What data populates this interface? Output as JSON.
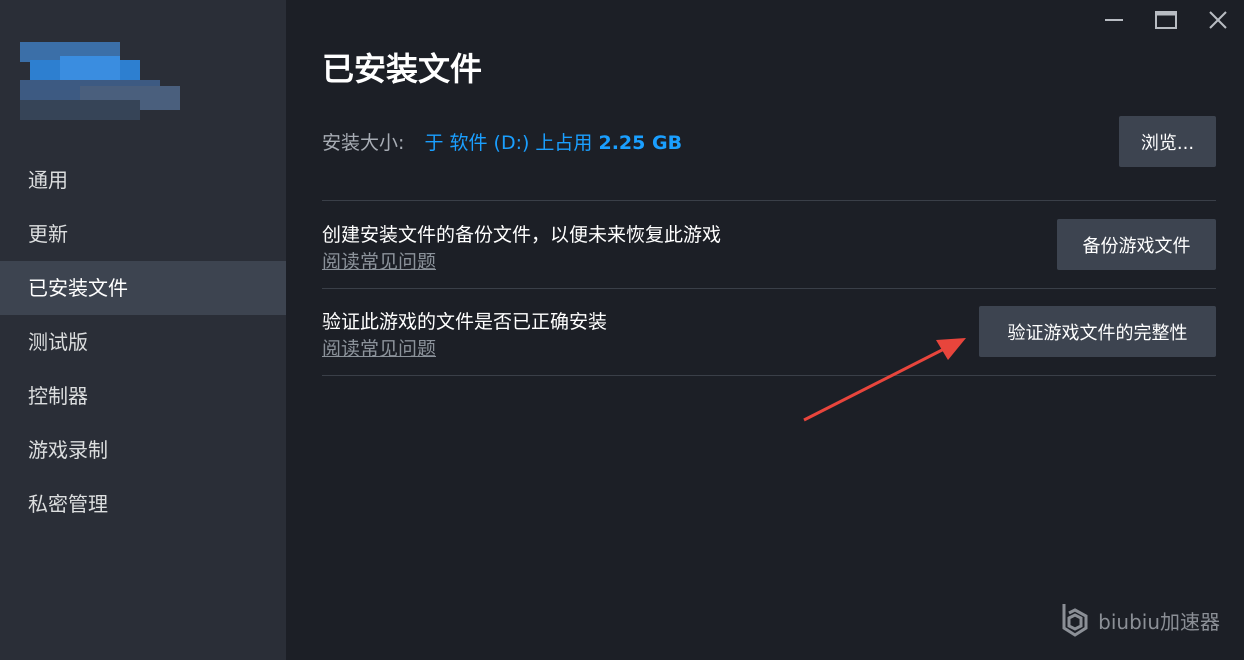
{
  "sidebar": {
    "items": [
      {
        "label": "通用"
      },
      {
        "label": "更新"
      },
      {
        "label": "已安装文件"
      },
      {
        "label": "测试版"
      },
      {
        "label": "控制器"
      },
      {
        "label": "游戏录制"
      },
      {
        "label": "私密管理"
      }
    ],
    "active_index": 2
  },
  "header": {
    "title": "已安装文件"
  },
  "install_size": {
    "label": "安装大小:",
    "value_prefix": "于 软件 (D:) 上占用",
    "value_size": "2.25 GB"
  },
  "buttons": {
    "browse": "浏览...",
    "backup": "备份游戏文件",
    "verify": "验证游戏文件的完整性"
  },
  "rows": {
    "backup_text": "创建安装文件的备份文件，以便未来恢复此游戏",
    "backup_faq": "阅读常见问题",
    "verify_text": "验证此游戏的文件是否已正确安装",
    "verify_faq": "阅读常见问题"
  },
  "watermark": {
    "text": "biubiu加速器"
  },
  "icons": {
    "minimize": "minimize-icon",
    "maximize": "maximize-icon",
    "close": "close-icon",
    "arrow": "red-arrow-annotation",
    "watermark_logo": "biubiu-logo-icon"
  },
  "colors": {
    "accent": "#1a9fff",
    "arrow": "#e8453c",
    "sidebar_bg": "#2a2e37",
    "main_bg": "#1c1f26",
    "active_item": "#3d4450"
  }
}
